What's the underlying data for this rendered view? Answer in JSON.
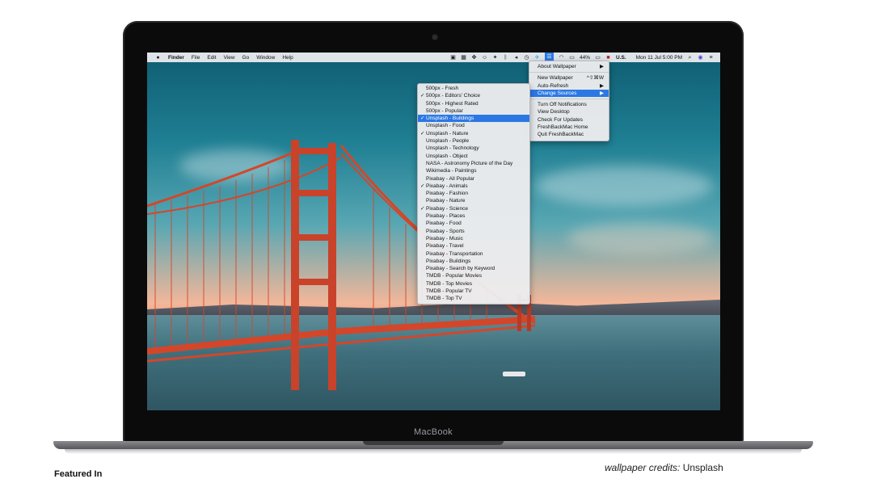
{
  "laptop": {
    "brand_label": "MacBook"
  },
  "menubar": {
    "apple_icon": "apple-icon",
    "app_name": "Finder",
    "menus": [
      "File",
      "Edit",
      "View",
      "Go",
      "Window",
      "Help"
    ],
    "status_icons": [
      "trello-icon",
      "calendar-icon",
      "gift-icon",
      "smiley-icon",
      "puzzle-icon",
      "bluetooth-icon",
      "volume-icon",
      "time-machine-icon",
      "twitter-icon",
      "freshback-icon",
      "wifi-icon",
      "airplay-icon"
    ],
    "battery": "44%",
    "locale": "U.S.",
    "datetime": "Mon 11 Jul  5:00 PM"
  },
  "app_menu": {
    "items": [
      {
        "label": "About Wallpaper",
        "shortcut": "",
        "submenu": true
      },
      {
        "label": "New Wallpaper",
        "shortcut": "^⇧⌘W",
        "submenu": false
      },
      {
        "label": "Auto-Refresh",
        "shortcut": "",
        "submenu": true
      },
      {
        "label": "Change Sources",
        "shortcut": "",
        "submenu": true
      },
      {
        "label": "Turn Off Notifications",
        "shortcut": "",
        "submenu": false
      },
      {
        "label": "View Desktop",
        "shortcut": "",
        "submenu": false
      },
      {
        "label": "Check For Updates",
        "shortcut": "",
        "submenu": false
      },
      {
        "label": "FreshBackMac Home",
        "shortcut": "",
        "submenu": false
      },
      {
        "label": "Quit FreshBackMac",
        "shortcut": "",
        "submenu": false
      }
    ]
  },
  "sources_menu": {
    "items": [
      {
        "label": "500px - Fresh",
        "checked": false
      },
      {
        "label": "500px - Editors' Choice",
        "checked": true
      },
      {
        "label": "500px - Highest Rated",
        "checked": false
      },
      {
        "label": "500px - Popular",
        "checked": false
      },
      {
        "label": "Unsplash - Buildings",
        "checked": true
      },
      {
        "label": "Unsplash - Food",
        "checked": false
      },
      {
        "label": "Unsplash - Nature",
        "checked": true
      },
      {
        "label": "Unsplash - People",
        "checked": false
      },
      {
        "label": "Unsplash - Technology",
        "checked": false
      },
      {
        "label": "Unsplash - Object",
        "checked": false
      },
      {
        "label": "NASA - Astronomy Picture of the Day",
        "checked": false
      },
      {
        "label": "Wikimedia - Paintings",
        "checked": false
      },
      {
        "label": "Pixabay - All Popular",
        "checked": false
      },
      {
        "label": "Pixabay - Animals",
        "checked": true
      },
      {
        "label": "Pixabay - Fashion",
        "checked": false
      },
      {
        "label": "Pixabay - Nature",
        "checked": false
      },
      {
        "label": "Pixabay - Science",
        "checked": true
      },
      {
        "label": "Pixabay - Places",
        "checked": false
      },
      {
        "label": "Pixabay - Food",
        "checked": false
      },
      {
        "label": "Pixabay - Sports",
        "checked": false
      },
      {
        "label": "Pixabay - Music",
        "checked": false
      },
      {
        "label": "Pixabay - Travel",
        "checked": false
      },
      {
        "label": "Pixabay - Transportation",
        "checked": false
      },
      {
        "label": "Pixabay - Buildings",
        "checked": false
      },
      {
        "label": "Pixabay - Search by Keyword",
        "checked": false
      },
      {
        "label": "TMDB - Popular Movies",
        "checked": false
      },
      {
        "label": "TMDB - Top Movies",
        "checked": false
      },
      {
        "label": "TMDB - Popular TV",
        "checked": false
      },
      {
        "label": "TMDB - Top TV",
        "checked": false
      }
    ],
    "highlighted": "Unsplash - Buildings"
  },
  "caption": {
    "credits_label": "wallpaper credits:",
    "credits_value": "Unsplash",
    "featured": "Featured In"
  },
  "colors": {
    "accent": "#2b78e4",
    "bridge": "#d4462a"
  }
}
